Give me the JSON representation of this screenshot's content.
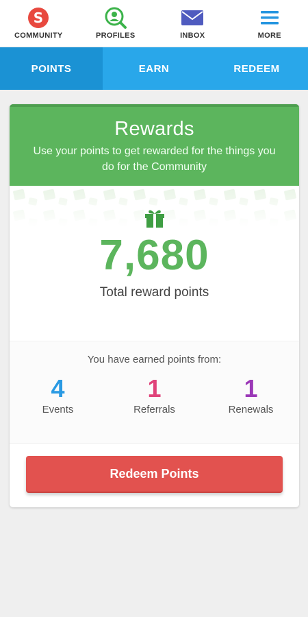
{
  "topnav": {
    "items": [
      {
        "label": "COMMUNITY",
        "icon": "community-logo-icon",
        "color": "#e8493f"
      },
      {
        "label": "PROFILES",
        "icon": "profile-search-icon",
        "color": "#3cb34a"
      },
      {
        "label": "INBOX",
        "icon": "envelope-icon",
        "color": "#4f5bbf"
      },
      {
        "label": "MORE",
        "icon": "hamburger-menu-icon",
        "color": "#2696e0"
      }
    ]
  },
  "tabs": [
    {
      "label": "POINTS",
      "active": true
    },
    {
      "label": "EARN",
      "active": false
    },
    {
      "label": "REDEEM",
      "active": false
    }
  ],
  "card": {
    "title": "Rewards",
    "subtitle": "Use your points to get rewarded for the things you do for the Community",
    "points": "7,680",
    "points_label": "Total reward points",
    "earned_title": "You have earned points from:",
    "stats": [
      {
        "value": "4",
        "label": "Events",
        "color": "#2a9ae3"
      },
      {
        "value": "1",
        "label": "Referrals",
        "color": "#e0437a"
      },
      {
        "value": "1",
        "label": "Renewals",
        "color": "#9b38b7"
      }
    ],
    "redeem_label": "Redeem Points"
  },
  "colors": {
    "green": "#5cb55d",
    "blue": "#29a7ea",
    "red": "#e2524f"
  }
}
